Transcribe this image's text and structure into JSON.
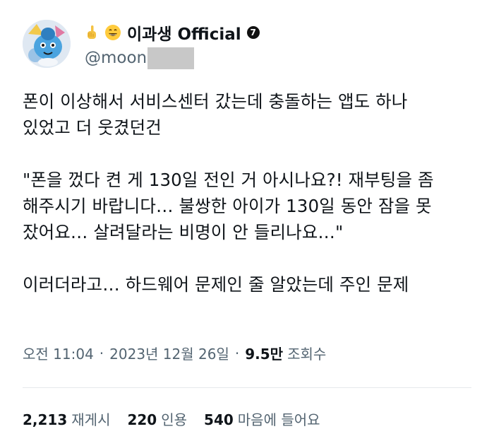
{
  "author": {
    "display_name": "이과생 Official",
    "badge": "7",
    "handle": "@moon",
    "avatar_icon": "pokemon-avatar",
    "name_emojis": [
      "pointing-hand-emoji",
      "grinning-face-emoji"
    ]
  },
  "tweet": {
    "lines": [
      "폰이 이상해서 서비스센터 갔는데 충돌하는 앱도 하나",
      "있었고 더 웃겼던건",
      "",
      "\"폰을 껐다 켠 게 130일 전인 거 아시나요?! 재부팅을 좀",
      "해주시기 바랍니다… 불쌍한 아이가 130일 동안 잠을 못",
      "잤어요… 살려달라는 비명이 안 들리나요…\"",
      "",
      "이러더라고… 하드웨어 문제인 줄 알았는데 주인 문제"
    ]
  },
  "meta": {
    "time": "오전 11:04",
    "separator": "·",
    "date": "2023년 12월 26일",
    "views_count": "9.5만",
    "views_label": "조회수"
  },
  "stats": {
    "retweets_count": "2,213",
    "retweets_label": "재게시",
    "quotes_count": "220",
    "quotes_label": "인용",
    "likes_count": "540",
    "likes_label": "마음에 들어요"
  },
  "colors": {
    "text": "#0f1419",
    "secondary": "#536471",
    "redaction": "#c8c8c8"
  }
}
